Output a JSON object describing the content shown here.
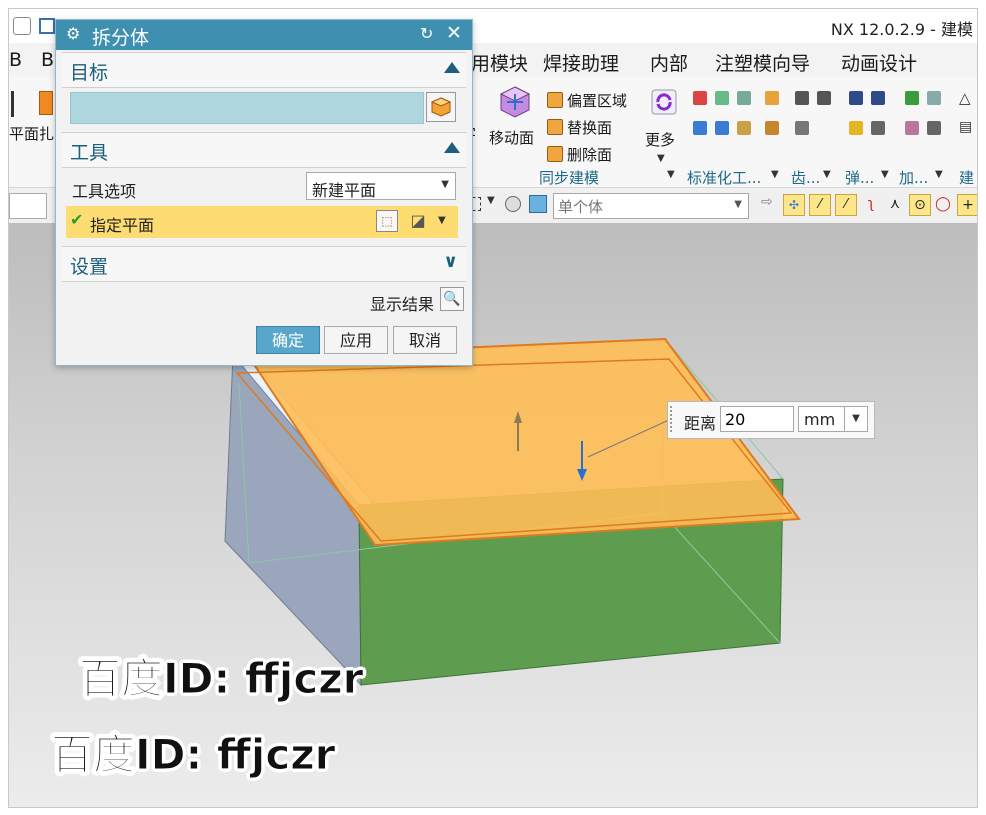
{
  "app": {
    "title": "NX 12.0.2.9 - 建模"
  },
  "menubar": {
    "partial_left_1": "B",
    "partial_left_2": "B",
    "items": [
      "用模块",
      "焊接助理",
      "内部",
      "注塑模向导",
      "动画设计"
    ]
  },
  "ribbon": {
    "left_partial_1": "平面",
    "left_partial_2": "扎",
    "move_face_label": "移动面",
    "offset_region_label": "偏置区域",
    "replace_face_label": "替换面",
    "delete_face_label": "删除面",
    "more_label": "更多",
    "groups": {
      "sync_modeling": "同步建模",
      "standard_tools": "标准化工...",
      "gear": "齿...",
      "spring": "弹...",
      "machining": "加...",
      "build": "建"
    },
    "partial_3": "字"
  },
  "selection_bar": {
    "filter_value": "单个体"
  },
  "dialog": {
    "title": "拆分体",
    "sections": {
      "target": "目标",
      "tool": "工具",
      "settings": "设置"
    },
    "tool_option_label": "工具选项",
    "tool_option_value": "新建平面",
    "specify_plane_label": "指定平面",
    "show_result_label": "显示结果",
    "buttons": {
      "ok": "确定",
      "apply": "应用",
      "cancel": "取消"
    }
  },
  "distance_box": {
    "label": "距离",
    "value": "20",
    "unit": "mm"
  },
  "watermark": {
    "line1": "百度ID: ffjczr",
    "line2": "百度ID: ffjczr"
  },
  "colors": {
    "dialog_title_bg": "#3f8fb0",
    "accent_text": "#1b5e7e",
    "target_field_bg": "#add6df",
    "highlight_yellow": "#fddc72",
    "plane_orange": "#ffbe55",
    "face_green": "#5e9c50",
    "face_blue": "#9aa6bb"
  }
}
